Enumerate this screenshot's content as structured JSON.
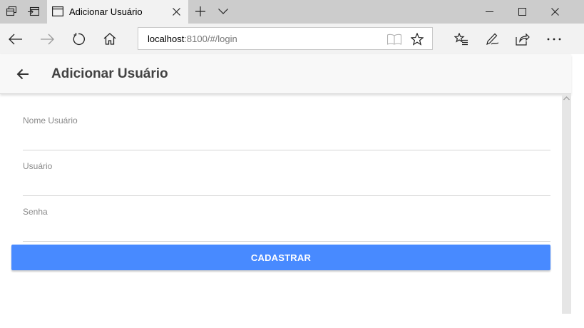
{
  "browser": {
    "tab": {
      "title": "Adicionar Usuário"
    },
    "address_bar": {
      "host": "localhost",
      "path": ":8100/#/login"
    },
    "icons": {
      "tab_actions": [
        "tab-set-aside-icon",
        "tab-preview-icon"
      ],
      "navigation": [
        "back-arrow-icon",
        "forward-arrow-icon",
        "refresh-icon",
        "home-icon"
      ],
      "address": [
        "reading-view-icon",
        "favorite-star-icon"
      ],
      "toolbar": [
        "favorites-hub-icon",
        "web-note-icon",
        "share-icon",
        "more-icon"
      ],
      "window": [
        "minimize-icon",
        "maximize-icon",
        "close-icon"
      ]
    }
  },
  "app": {
    "header": {
      "title": "Adicionar Usuário"
    },
    "form": {
      "fields": [
        {
          "label": "Nome Usuário",
          "value": ""
        },
        {
          "label": "Usuário",
          "value": ""
        },
        {
          "label": "Senha",
          "value": ""
        }
      ],
      "submit_label": "CADASTRAR"
    },
    "colors": {
      "primary": "#488aff",
      "header_bg": "#f8f8f8",
      "label": "#8a8a8a",
      "title": "#424242"
    }
  }
}
